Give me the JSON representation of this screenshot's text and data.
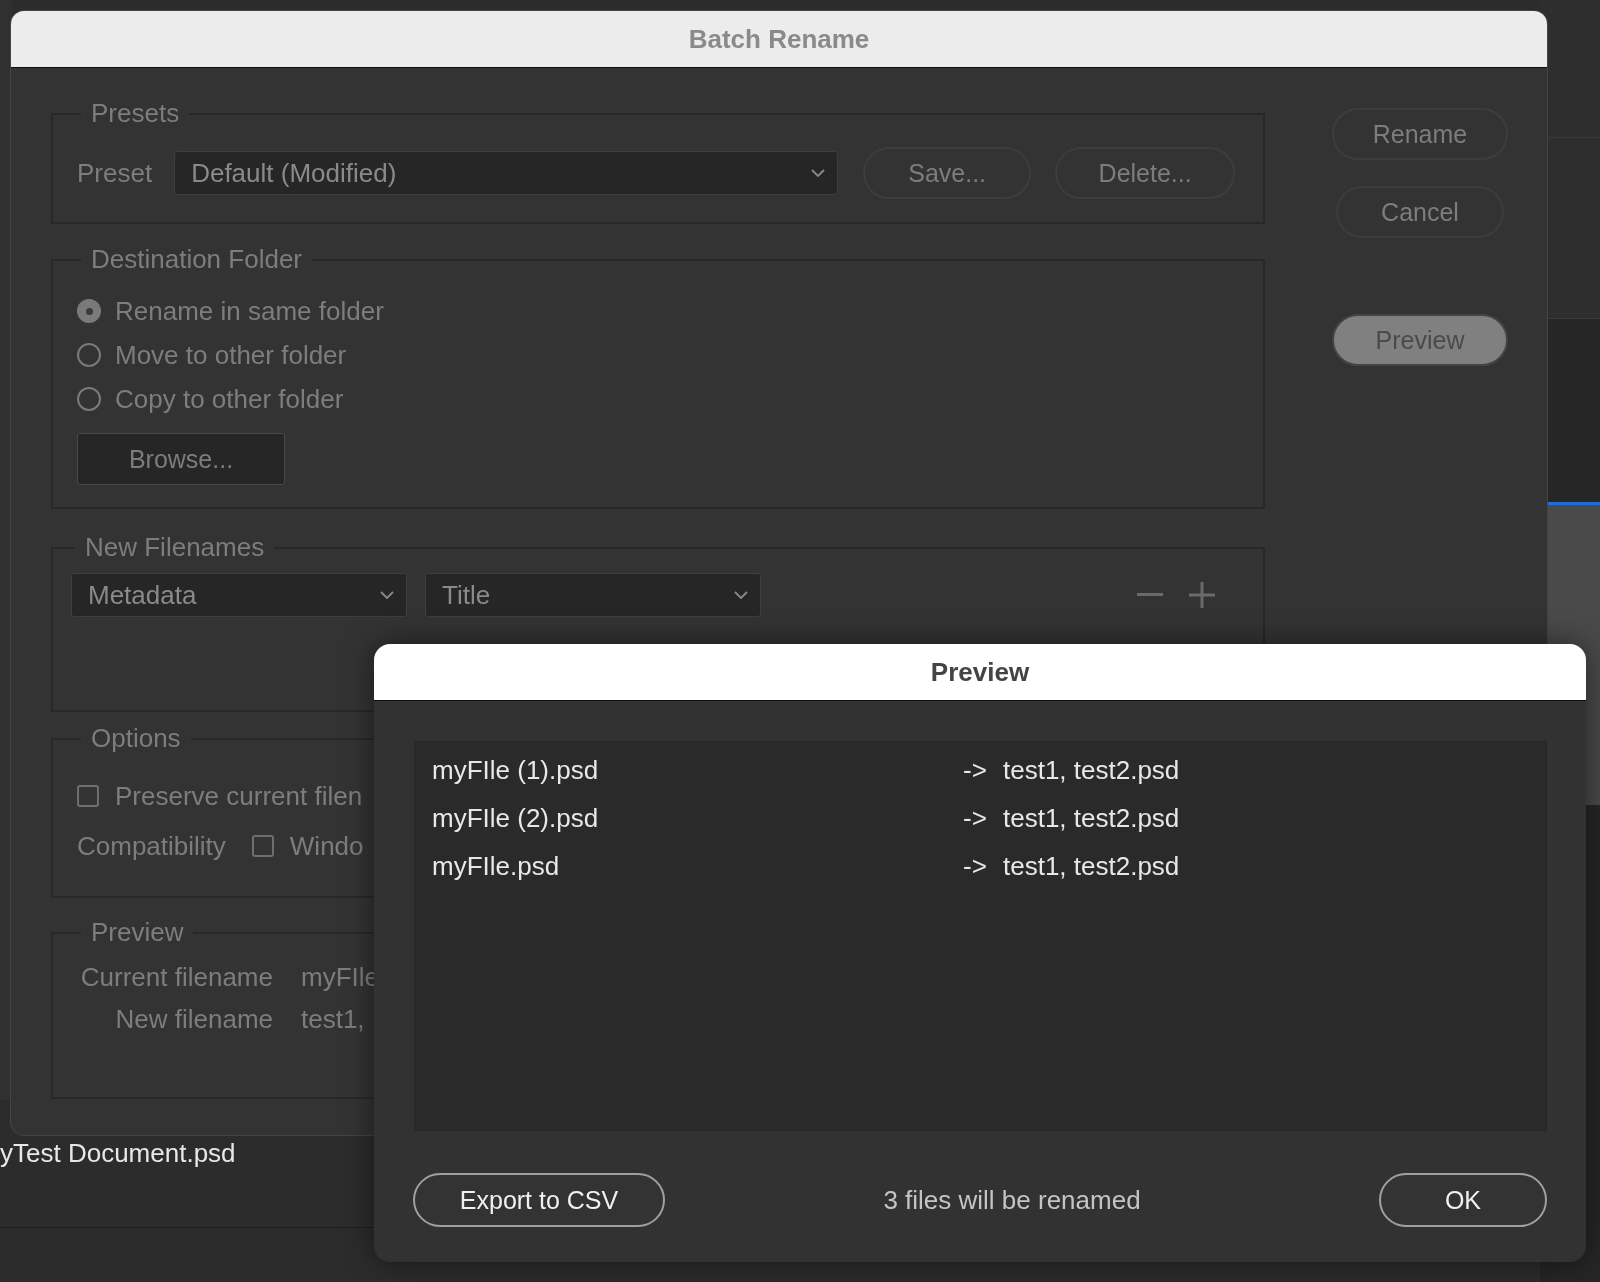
{
  "background": {
    "file_label": "yTest Document.psd"
  },
  "main_dialog": {
    "title": "Batch Rename",
    "presets": {
      "legend": "Presets",
      "label": "Preset",
      "value": "Default (Modified)",
      "buttons": [
        "Save...",
        "Delete..."
      ]
    },
    "destination_folder": {
      "legend": "Destination Folder",
      "options": [
        {
          "label": "Rename in same folder",
          "selected": true
        },
        {
          "label": "Move to other folder",
          "selected": false
        },
        {
          "label": "Copy to other folder",
          "selected": false
        }
      ],
      "browse_button": "Browse..."
    },
    "new_filenames": {
      "legend": "New Filenames",
      "dropdowns": [
        "Metadata",
        "Title"
      ]
    },
    "options": {
      "legend": "Options",
      "preserve": {
        "label": "Preserve current filen",
        "checked": false
      },
      "compatibility_label": "Compatibility",
      "compatibility": {
        "label": "Windo",
        "checked": false
      }
    },
    "preview": {
      "legend": "Preview",
      "rows": [
        {
          "label": "Current filename",
          "value": "myFIle"
        },
        {
          "label": "New filename",
          "value": "test1,"
        }
      ]
    },
    "side_buttons": [
      {
        "label": "Rename",
        "disabled": false
      },
      {
        "label": "Cancel",
        "disabled": false
      },
      {
        "label": "Preview",
        "disabled": true
      }
    ]
  },
  "preview_dialog": {
    "title": "Preview",
    "rows": [
      {
        "source": "myFIle (1).psd",
        "arrow": "->",
        "target": "test1, test2.psd"
      },
      {
        "source": "myFIle (2).psd",
        "arrow": "->",
        "target": "test1, test2.psd"
      },
      {
        "source": "myFIle.psd",
        "arrow": "->",
        "target": "test1, test2.psd"
      }
    ],
    "export_button": "Export to CSV",
    "status": "3 files will be renamed",
    "ok_button": "OK"
  }
}
